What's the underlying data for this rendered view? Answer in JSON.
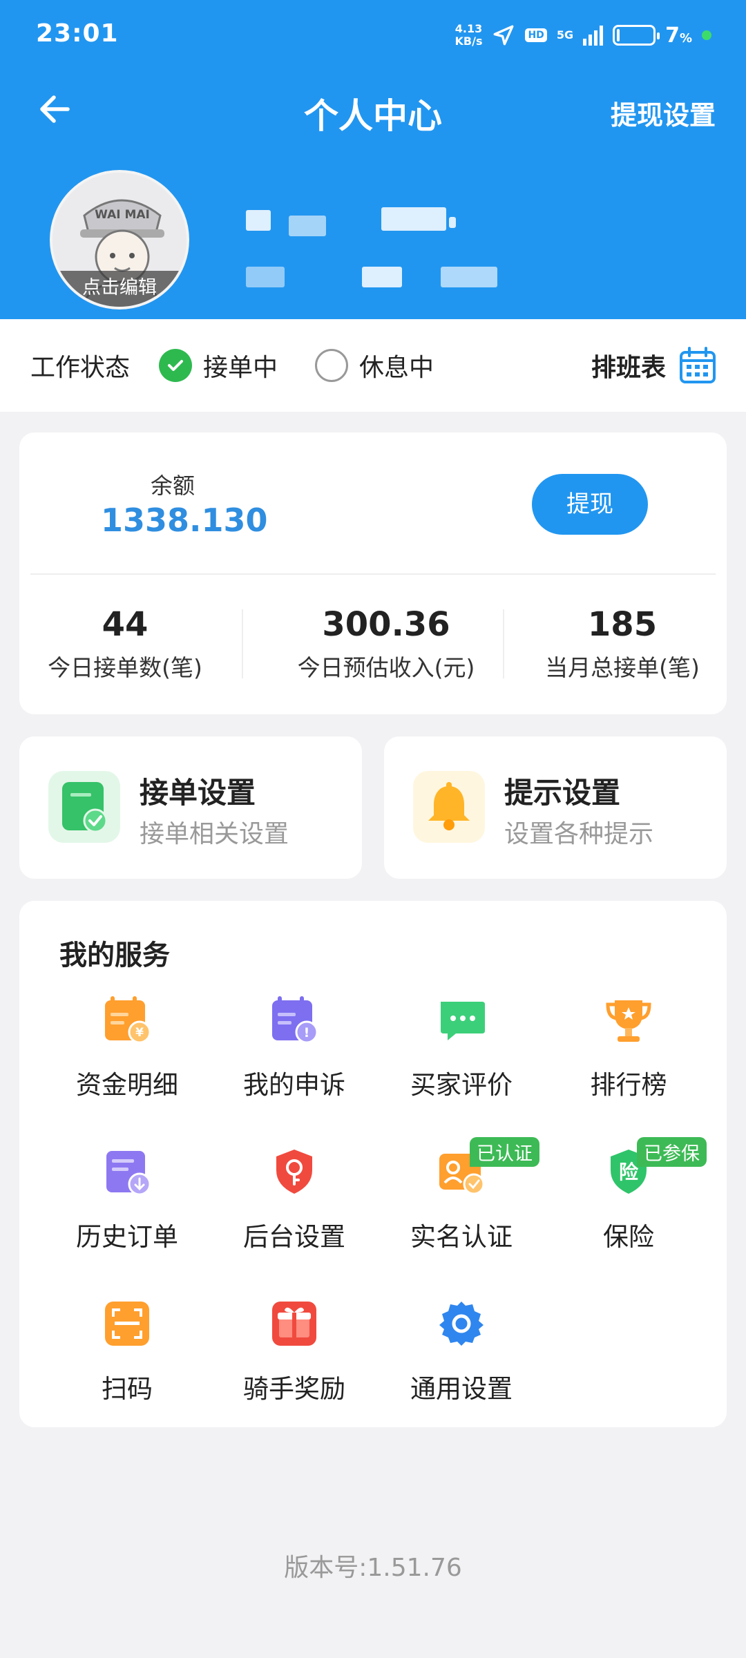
{
  "status_bar": {
    "time": "23:01",
    "net_speed_value": "4.13",
    "net_speed_unit": "KB/s",
    "hd": "HD",
    "network": "5G",
    "battery_percent": "7",
    "battery_unit": "%",
    "battery_level": 0.07
  },
  "nav": {
    "title": "个人中心",
    "right_label": "提现设置",
    "back_icon": "arrow-left-icon"
  },
  "profile": {
    "avatar_text": "WAI MAI",
    "edit_label": "点击编辑"
  },
  "work_status": {
    "label": "工作状态",
    "option_active": "接单中",
    "option_rest": "休息中",
    "selected": "接单中",
    "schedule_label": "排班表"
  },
  "balance": {
    "label": "余额",
    "value": "1338.130",
    "withdraw_label": "提现"
  },
  "stats": [
    {
      "value": "44",
      "label": "今日接单数(笔)"
    },
    {
      "value": "300.36",
      "label": "今日预估收入(元)"
    },
    {
      "value": "185",
      "label": "当月总接单(笔)"
    }
  ],
  "settings": [
    {
      "title": "接单设置",
      "subtitle": "接单相关设置",
      "icon": "order-settings-icon"
    },
    {
      "title": "提示设置",
      "subtitle": "设置各种提示",
      "icon": "bell-icon"
    }
  ],
  "services": {
    "title": "我的服务",
    "items": [
      {
        "label": "资金明细",
        "icon": "fund-detail-icon"
      },
      {
        "label": "我的申诉",
        "icon": "appeal-icon"
      },
      {
        "label": "买家评价",
        "icon": "review-icon"
      },
      {
        "label": "排行榜",
        "icon": "trophy-icon"
      },
      {
        "label": "历史订单",
        "icon": "history-order-icon"
      },
      {
        "label": "后台设置",
        "icon": "backend-settings-icon"
      },
      {
        "label": "实名认证",
        "icon": "id-verify-icon",
        "badge": "已认证"
      },
      {
        "label": "保险",
        "icon": "insurance-icon",
        "badge": "已参保"
      },
      {
        "label": "扫码",
        "icon": "scan-icon"
      },
      {
        "label": "骑手奖励",
        "icon": "gift-icon"
      },
      {
        "label": "通用设置",
        "icon": "gear-icon"
      }
    ]
  },
  "version": "版本号:1.51.76",
  "colors": {
    "primary": "#2196f0",
    "balance_text": "#2f8ee0",
    "success": "#2eb94f"
  }
}
